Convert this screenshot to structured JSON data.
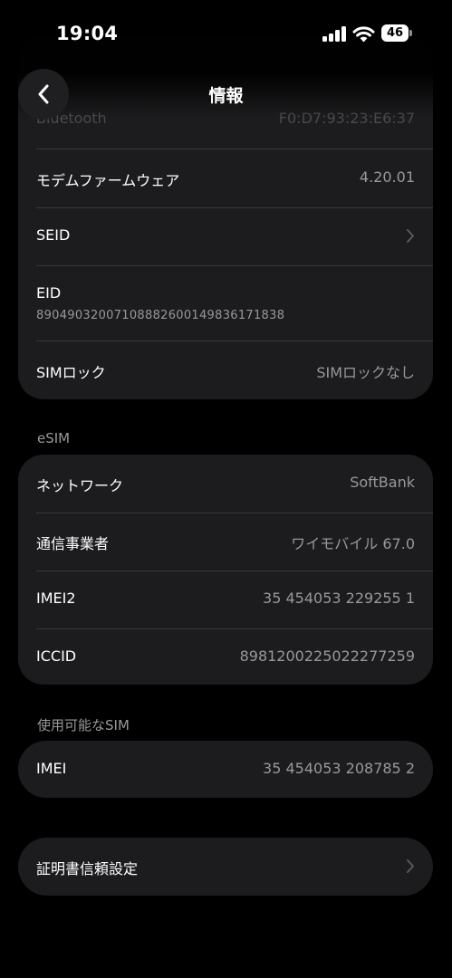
{
  "status_bar": {
    "time": "19:04",
    "battery": "46"
  },
  "nav": {
    "title": "情報"
  },
  "ghost_row": {
    "label": "",
    "value": ""
  },
  "group_device": {
    "rows": [
      {
        "label": "Bluetooth",
        "value": "F0:D7:93:23:E6:37"
      },
      {
        "label": "モデムファームウェア",
        "value": "4.20.01"
      },
      {
        "label": "SEID"
      },
      {
        "label": "EID",
        "sub": "89049032007108882600149836171838"
      },
      {
        "label": "SIMロック",
        "value": "SIMロックなし"
      }
    ]
  },
  "esim": {
    "header": "eSIM",
    "rows": [
      {
        "label": "ネットワーク",
        "value": "SoftBank"
      },
      {
        "label": "通信事業者",
        "value": "ワイモバイル 67.0"
      },
      {
        "label": "IMEI2",
        "value": "35 454053 229255 1"
      },
      {
        "label": "ICCID",
        "value": "8981200225022277259"
      }
    ]
  },
  "available_sim": {
    "header": "使用可能なSIM",
    "rows": [
      {
        "label": "IMEI",
        "value": "35 454053 208785 2"
      }
    ]
  },
  "certificate": {
    "label": "証明書信頼設定"
  },
  "colors": {
    "background": "#000000",
    "card": "#1c1c1e",
    "separator": "#38383a",
    "secondary_text": "#98989d"
  }
}
